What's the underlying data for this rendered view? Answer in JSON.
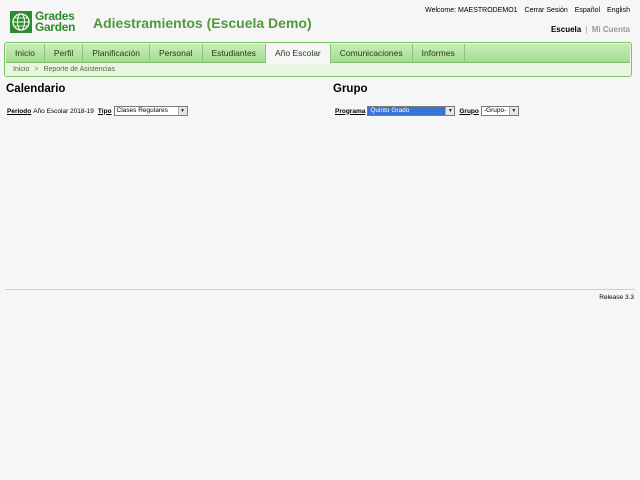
{
  "brand": {
    "line1": "Grades",
    "line2": "Garden"
  },
  "school_title": "Adiestramientos (Escuela Demo)",
  "top_links": {
    "welcome": "Welcome: MAESTRODEMO1",
    "logout": "Cerrar Sesión",
    "spanish": "Español",
    "english": "English"
  },
  "account_switch": {
    "school": "Escuela",
    "separator": "|",
    "my_account": "Mi Cuenta"
  },
  "nav": {
    "tabs": [
      "Inicio",
      "Perfil",
      "Planificación",
      "Personal",
      "Estudiantes",
      "Año Escolar",
      "Comunicaciones",
      "Informes"
    ],
    "selected": "Año Escolar"
  },
  "breadcrumb": {
    "home": "Inicio",
    "separator": ">",
    "current": "Reporte de Asistencias"
  },
  "calendario": {
    "title": "Calendario",
    "period_label": "Periodo",
    "period_value": "Año Escolar 2018-19",
    "type_label": "Tipo",
    "type_value": "Clases Regulares"
  },
  "grupo": {
    "title": "Grupo",
    "program_label": "Programa",
    "program_value": "Quinto Grado",
    "group_label": "Grupo",
    "group_value": "-Grupo-"
  },
  "footer": {
    "release": "Release 3.3"
  },
  "icons": {
    "dropdown": "chevron-down-icon",
    "logo": "globe-logo-icon"
  },
  "colors": {
    "brand_green": "#2e8b2e",
    "nav_green": "#a6dc92",
    "selection_blue": "#3a73d6"
  }
}
